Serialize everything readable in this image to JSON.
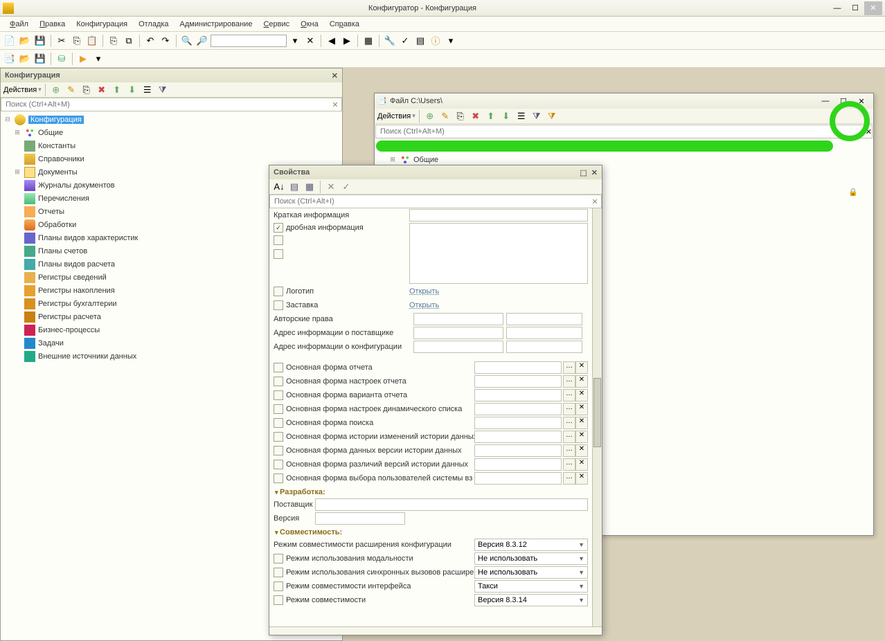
{
  "titlebar": {
    "text": "Конфигуратор - Конфигурация"
  },
  "menu": {
    "file": "Файл",
    "edit": "Правка",
    "config": "Конфигурация",
    "debug": "Отладка",
    "admin": "Администрирование",
    "service": "Сервис",
    "windows": "Окна",
    "help": "Справка"
  },
  "config_panel": {
    "title": "Конфигурация",
    "actions": "Действия",
    "search_ph": "Поиск (Ctrl+Alt+M)",
    "tree": {
      "root": "Конфигурация",
      "items": [
        {
          "label": "Общие"
        },
        {
          "label": "Константы"
        },
        {
          "label": "Справочники"
        },
        {
          "label": "Документы"
        },
        {
          "label": "Журналы документов"
        },
        {
          "label": "Перечисления"
        },
        {
          "label": "Отчеты"
        },
        {
          "label": "Обработки"
        },
        {
          "label": "Планы видов характеристик"
        },
        {
          "label": "Планы счетов"
        },
        {
          "label": "Планы видов расчета"
        },
        {
          "label": "Регистры сведений"
        },
        {
          "label": "Регистры накопления"
        },
        {
          "label": "Регистры бухгалтерии"
        },
        {
          "label": "Регистры расчета"
        },
        {
          "label": "Бизнес-процессы"
        },
        {
          "label": "Задачи"
        },
        {
          "label": "Внешние источники данных"
        }
      ]
    }
  },
  "file_win": {
    "title": "Файл C:\\Users\\",
    "actions": "Действия",
    "search_ph": "Поиск (Ctrl+Alt+M)",
    "tree_item": "Общие"
  },
  "props": {
    "title": "Свойства",
    "search_ph": "Поиск (Ctrl+Alt+I)",
    "brief": "Краткая информация",
    "detailed": "дробная информация",
    "logo": "Логотип",
    "splash": "Заставка",
    "open": "Открыть",
    "copyright": "Авторские права",
    "vendor_addr": "Адрес информации о поставщике",
    "config_addr": "Адрес информации о конфигурации",
    "forms": [
      "Основная форма отчета",
      "Основная форма настроек отчета",
      "Основная форма варианта отчета",
      "Основная форма настроек динамического списка",
      "Основная форма поиска",
      "Основная форма истории изменений истории данных",
      "Основная форма данных версии истории данных",
      "Основная форма различий версий истории данных",
      "Основная форма выбора пользователей системы вз"
    ],
    "dev_section": "Разработка:",
    "vendor": "Поставщик",
    "version": "Версия",
    "compat_section": "Совместимость:",
    "compat_ext": "Режим совместимости расширения конфигурации",
    "compat_ext_val": "Версия 8.3.12",
    "modality": "Режим использования модальности",
    "modality_val": "Не использовать",
    "sync": "Режим использования синхронных вызовов расшире",
    "sync_val": "Не использовать",
    "iface": "Режим совместимости интерфейса",
    "iface_val": "Такси",
    "compat": "Режим совместимости",
    "compat_val": "Версия 8.3.14"
  }
}
